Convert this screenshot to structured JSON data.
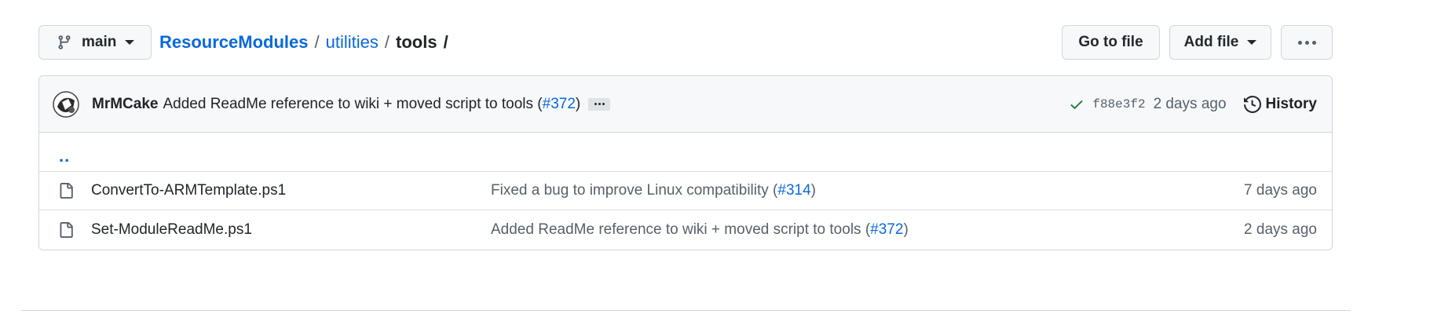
{
  "toolbar": {
    "branch": "main",
    "breadcrumb": {
      "repo": "ResourceModules",
      "sep1": "/",
      "folder": "utilities",
      "sep2": "/",
      "current": "tools",
      "sep3": "/"
    },
    "go_to_file": "Go to file",
    "add_file": "Add file"
  },
  "commit": {
    "author": "MrMCake",
    "message": "Added ReadMe reference to wiki + moved script to tools (",
    "pr": "#372",
    "message_end": ")",
    "sha": "f88e3f2",
    "time": "2 days ago",
    "history": "History",
    "status_color": "#1a7f37"
  },
  "parent_dir": "..",
  "files": [
    {
      "name": "ConvertTo-ARMTemplate.ps1",
      "commit_message": "Fixed a bug to improve Linux compatibility (",
      "pr": "#314",
      "commit_end": ")",
      "age": "7 days ago"
    },
    {
      "name": "Set-ModuleReadMe.ps1",
      "commit_message": "Added ReadMe reference to wiki + moved script to tools (",
      "pr": "#372",
      "commit_end": ")",
      "age": "2 days ago"
    }
  ],
  "icons": {
    "branch": "git-branch-icon",
    "caret": "chevron-down-icon",
    "more": "kebab-horizontal-icon",
    "check": "check-icon",
    "history": "history-icon",
    "file": "file-icon"
  },
  "colors": {
    "link": "#0969da",
    "border": "#d0d7de",
    "header_bg": "#f6f8fa",
    "muted": "#57606a"
  }
}
